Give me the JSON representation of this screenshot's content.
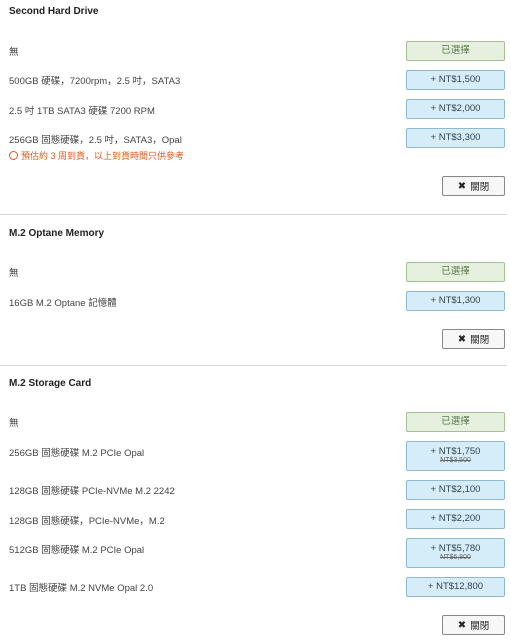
{
  "sections": [
    {
      "title": "Second Hard Drive",
      "options": [
        {
          "label": "無",
          "button": "已選擇",
          "selected": true
        },
        {
          "label": "500GB 硬碟，7200rpm，2.5 吋，SATA3",
          "button": "+ NT$1,500"
        },
        {
          "label": "2.5 吋 1TB SATA3 硬碟 7200 RPM",
          "button": "+ NT$2,000"
        },
        {
          "label": "256GB 固態硬碟，2.5 吋，SATA3，Opal",
          "button": "+ NT$3,300",
          "note": "預估約 3 周到貨，以上到貨時間只供參考"
        }
      ],
      "close": "關閉"
    },
    {
      "title": "M.2 Optane Memory",
      "options": [
        {
          "label": "無",
          "button": "已選擇",
          "selected": true
        },
        {
          "label": "16GB M.2 Optane 記憶體",
          "button": "+ NT$1,300"
        }
      ],
      "close": "關閉"
    },
    {
      "title": "M.2 Storage Card",
      "options": [
        {
          "label": "無",
          "button": "已選擇",
          "selected": true
        },
        {
          "label": "256GB 固態硬碟 M.2 PCIe Opal",
          "button": "+ NT$1,750",
          "old_price": "NT$3,500"
        },
        {
          "label": "128GB 固態硬碟 PCIe-NVMe M.2 2242",
          "button": "+ NT$2,100"
        },
        {
          "label": "128GB 固態硬碟，PCIe-NVMe，M.2",
          "button": "+ NT$2,200"
        },
        {
          "label": "512GB 固態硬碟 M.2 PCIe Opal",
          "button": "+ NT$5,780",
          "old_price": "NT$6,800"
        },
        {
          "label": "1TB 固態硬碟 M.2 NVMe Opal 2.0",
          "button": "+ NT$12,800"
        }
      ],
      "close": "關閉"
    }
  ]
}
